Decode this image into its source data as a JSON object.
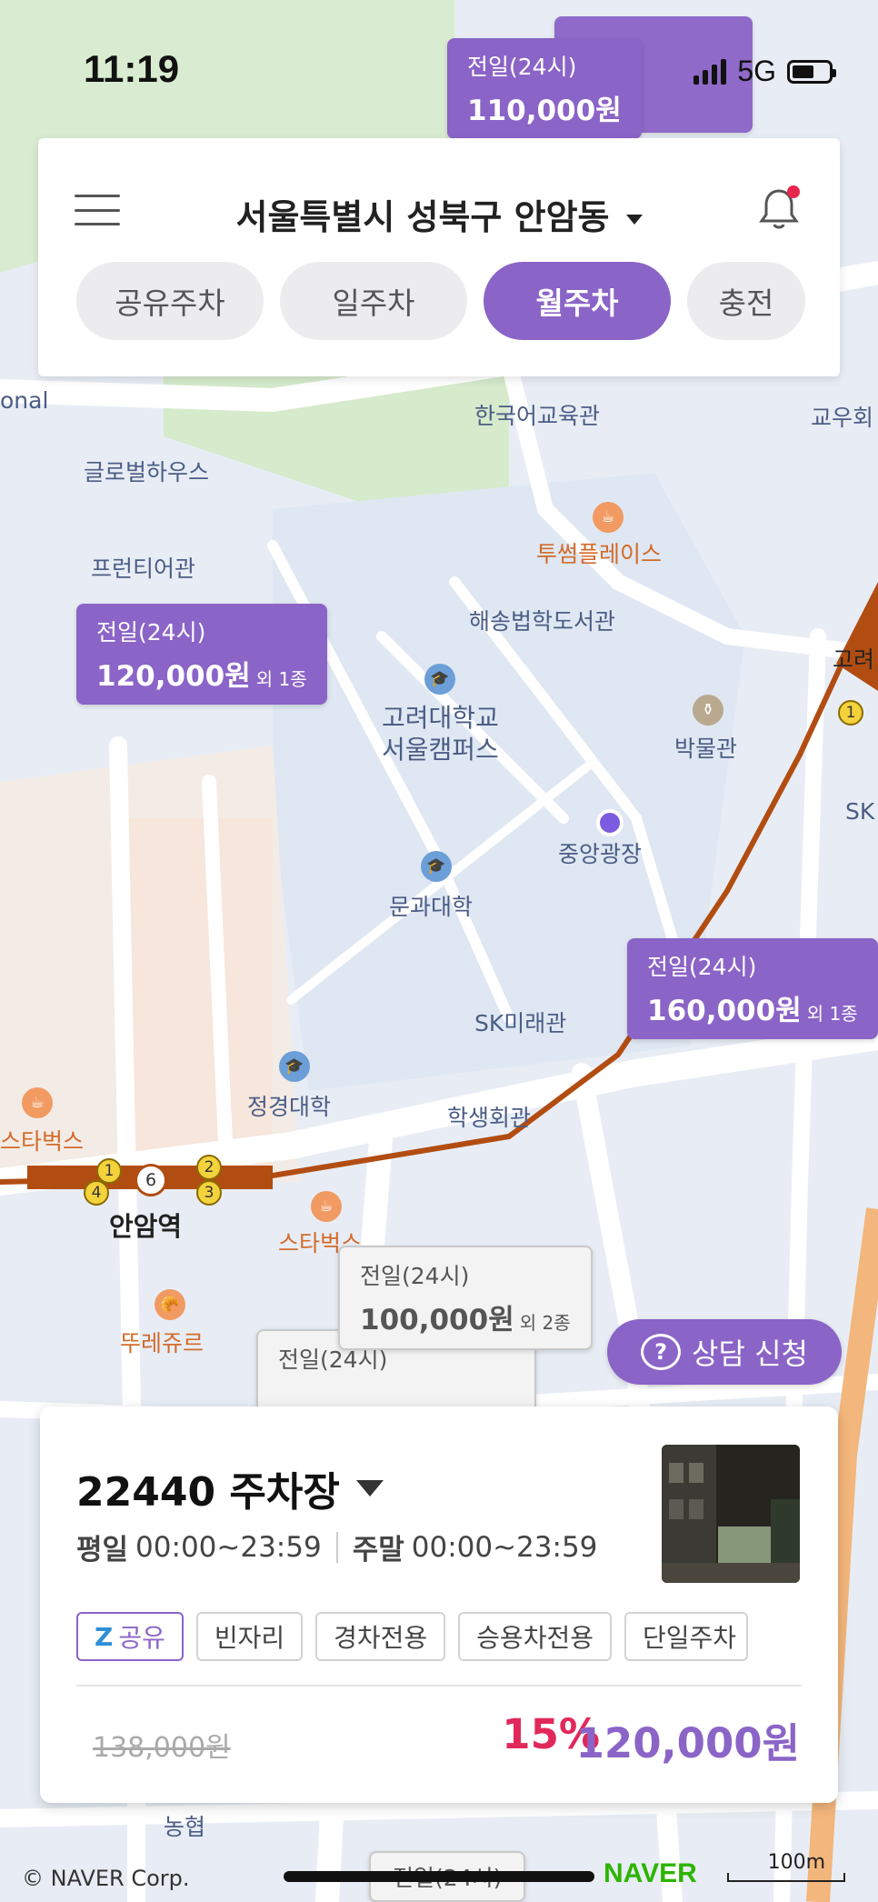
{
  "status_bar": {
    "time": "11:19",
    "network": "5G"
  },
  "header": {
    "location": "서울특별시 성북구 안암동",
    "tabs": [
      {
        "label": "공유주차",
        "active": false
      },
      {
        "label": "일주차",
        "active": false
      },
      {
        "label": "월주차",
        "active": true
      },
      {
        "label": "충전",
        "active": false
      }
    ]
  },
  "map": {
    "labels": {
      "korean_edu_hall": "한국어교육관",
      "faculty_hall": "교우회",
      "global_house": "글로벌하우스",
      "frontier": "프런티어관",
      "two_some": "투썸플레이스",
      "law_library": "해송법학도서관",
      "korea_univ": "고려대학교\n서울캠퍼스",
      "museum": "박물관",
      "central_plaza": "중앙광장",
      "liberal_arts": "문과대학",
      "sk_future": "SK미래관",
      "jeongkyung": "정경대학",
      "student_hall": "학생회관",
      "starbucks_1": "스타벅스",
      "starbucks_2": "스타벅스",
      "anam_station": "안암역",
      "tous": "뚜레쥬르",
      "nonghyup": "농협",
      "goryeo": "고려",
      "onal": "onal",
      "sk_edge": "SK"
    },
    "markers": [
      {
        "top_label": "전일(24시)",
        "price": "110,000원"
      },
      {
        "top_label": "전일(24시)",
        "price": "120,000원",
        "extra": "외 1종"
      },
      {
        "top_label": "전일(24시)",
        "price": "160,000원",
        "extra": "외 1종"
      },
      {
        "top_label": "전일(24시)",
        "price": "100,000원",
        "extra": "외 2종"
      },
      {
        "top_label": "전일(24시)",
        "price": ""
      },
      {
        "top_label": "전일(24시)",
        "price": ""
      }
    ]
  },
  "consult_button": {
    "label": "상담 신청"
  },
  "parking_card": {
    "name": "22440 주차장",
    "weekday_label": "평일",
    "weekday_hours": "00:00~23:59",
    "weekend_label": "주말",
    "weekend_hours": "00:00~23:59",
    "tags": [
      "공유",
      "빈자리",
      "경차전용",
      "승용차전용",
      "단일주차"
    ],
    "original_price": "138,000원",
    "discount": "15%",
    "final_price": "120,000원"
  },
  "footer": {
    "copyright": "© NAVER Corp.",
    "naver_logo": "NAVER",
    "scale": "100m"
  },
  "colors": {
    "accent": "#8b64c7",
    "discount": "#e2285a",
    "subway_line": "#b24d12"
  }
}
